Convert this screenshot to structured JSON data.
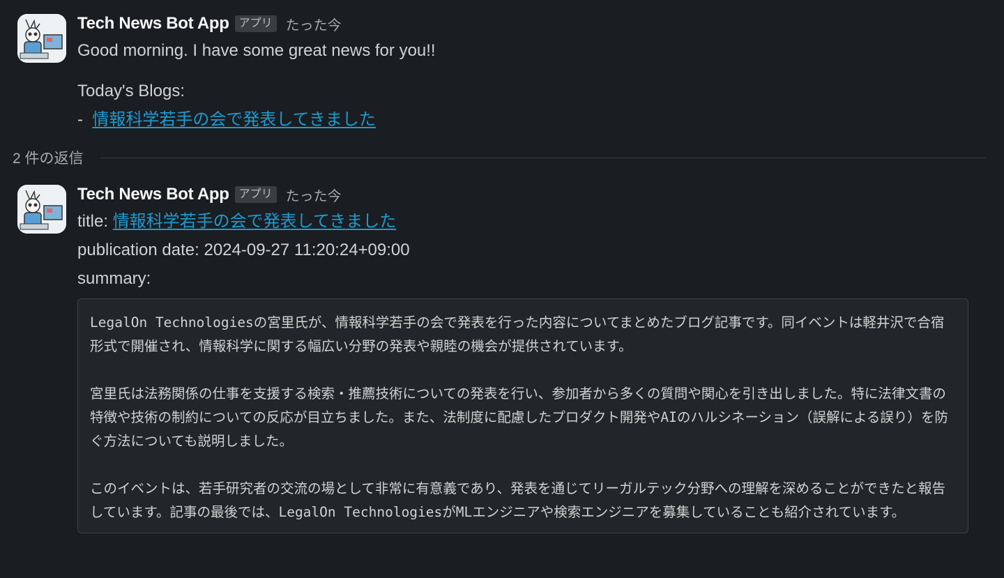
{
  "messages": [
    {
      "sender": "Tech News Bot App",
      "badge": "アプリ",
      "timestamp": "たった今",
      "greeting": "Good morning. I have some great news for you!!",
      "blogs_heading": "Today's Blogs:",
      "blog_bullet": "-",
      "blog_link": "情報科学若手の会で発表してきました"
    },
    {
      "sender": "Tech News Bot App",
      "badge": "アプリ",
      "timestamp": "たった今",
      "title_label": "title:",
      "title_link": "情報科学若手の会で発表してきました",
      "publication_date": "publication date: 2024-09-27 11:20:24+09:00",
      "summary_label": "summary:",
      "summary_paragraphs": [
        "LegalOn Technologiesの宮里氏が、情報科学若手の会で発表を行った内容についてまとめたブログ記事です。同イベントは軽井沢で合宿形式で開催され、情報科学に関する幅広い分野の発表や親睦の機会が提供されています。",
        "宮里氏は法務関係の仕事を支援する検索・推薦技術についての発表を行い、参加者から多くの質問や関心を引き出しました。特に法律文書の特徴や技術の制約についての反応が目立ちました。また、法制度に配慮したプロダクト開発やAIのハルシネーション（誤解による誤り）を防ぐ方法についても説明しました。",
        "このイベントは、若手研究者の交流の場として非常に有意義であり、発表を通じてリーガルテック分野への理解を深めることができたと報告しています。記事の最後では、LegalOn TechnologiesがMLエンジニアや検索エンジニアを募集していることも紹介されています。"
      ]
    }
  ],
  "replies": {
    "label": "2 件の返信"
  },
  "colors": {
    "background": "#1a1d21",
    "link": "#1d9bd1",
    "text": "#d1d2d3"
  },
  "icons": {
    "avatar": "bot-avatar-icon"
  }
}
